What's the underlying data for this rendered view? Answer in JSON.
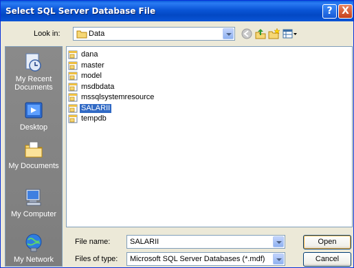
{
  "dialog": {
    "title": "Select SQL Server Database File",
    "help_glyph": "?",
    "close_glyph": "X"
  },
  "look_in": {
    "label": "Look in:",
    "value": "Data"
  },
  "toolbar": {
    "icons": [
      "back-icon",
      "up-folder-icon",
      "new-folder-icon",
      "view-menu-icon"
    ]
  },
  "places": [
    {
      "label": "My Recent Documents",
      "icon": "recent-documents-icon"
    },
    {
      "label": "Desktop",
      "icon": "desktop-icon"
    },
    {
      "label": "My Documents",
      "icon": "my-documents-icon"
    },
    {
      "label": "My Computer",
      "icon": "my-computer-icon"
    },
    {
      "label": "My Network",
      "icon": "my-network-icon"
    }
  ],
  "files": [
    {
      "name": "dana",
      "selected": false
    },
    {
      "name": "master",
      "selected": false
    },
    {
      "name": "model",
      "selected": false
    },
    {
      "name": "msdbdata",
      "selected": false
    },
    {
      "name": "mssqlsystemresource",
      "selected": false
    },
    {
      "name": "SALARII",
      "selected": true
    },
    {
      "name": "tempdb",
      "selected": false
    }
  ],
  "file_name": {
    "label": "File name:",
    "value": "SALARII"
  },
  "file_type": {
    "label": "Files of type:",
    "value": "Microsoft SQL Server Databases (*.mdf)"
  },
  "buttons": {
    "open": "Open",
    "cancel": "Cancel"
  },
  "colors": {
    "title_bar": "#0a55d6",
    "selection": "#316ac5",
    "places_bar": "#808080",
    "dialog_bg": "#ece9d8"
  }
}
